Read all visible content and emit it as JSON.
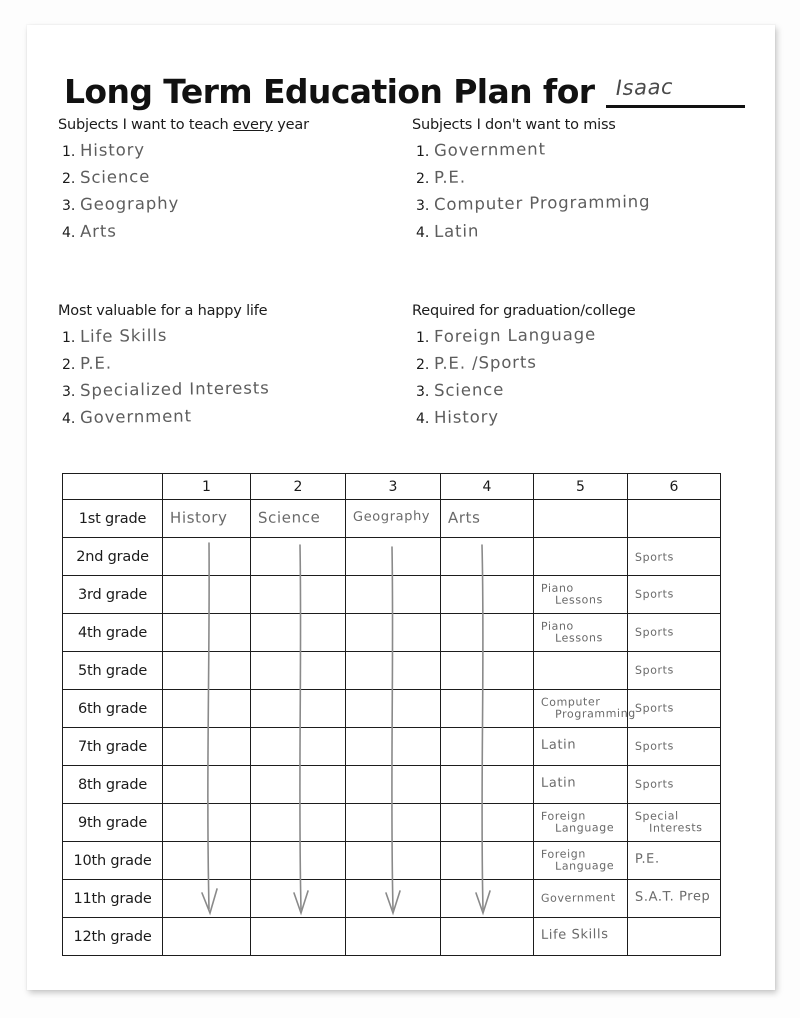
{
  "title": {
    "text": "Long Term Education Plan for",
    "name_value": "Isaac"
  },
  "lists": [
    {
      "heading_before": "Subjects I want to teach ",
      "heading_underline": "every",
      "heading_after": " year",
      "items": [
        "History",
        "Science",
        "Geography",
        "Arts"
      ],
      "numbers": [
        "1.",
        "2.",
        "3.",
        "4."
      ]
    },
    {
      "heading_before": "Subjects I don't want to miss",
      "heading_underline": "",
      "heading_after": "",
      "items": [
        "Government",
        "P.E.",
        "Computer Programming",
        "Latin"
      ],
      "numbers": [
        "1.",
        "2.",
        "3.",
        "4."
      ]
    },
    {
      "heading_before": "Most valuable for a happy life",
      "heading_underline": "",
      "heading_after": "",
      "items": [
        "Life Skills",
        "P.E.",
        "Specialized Interests",
        "Government"
      ],
      "numbers": [
        "1.",
        "2.",
        "3.",
        "4."
      ]
    },
    {
      "heading_before": "Required for graduation/college",
      "heading_underline": "",
      "heading_after": "",
      "items": [
        "Foreign Language",
        "P.E. /Sports",
        "Science",
        "History"
      ],
      "numbers": [
        "1.",
        "2.",
        "3.",
        "4."
      ]
    }
  ],
  "grid": {
    "corner_label": "",
    "columns": [
      "1",
      "2",
      "3",
      "4",
      "5",
      "6"
    ],
    "rows": [
      {
        "label": "1st grade",
        "cells": [
          "History",
          "Science",
          "Geography",
          "Arts",
          "",
          ""
        ]
      },
      {
        "label": "2nd grade",
        "cells": [
          "",
          "",
          "",
          "",
          "",
          "Sports"
        ]
      },
      {
        "label": "3rd grade",
        "cells": [
          "",
          "",
          "",
          "",
          "Piano Lessons",
          "Sports"
        ]
      },
      {
        "label": "4th grade",
        "cells": [
          "",
          "",
          "",
          "",
          "Piano Lessons",
          "Sports"
        ]
      },
      {
        "label": "5th grade",
        "cells": [
          "",
          "",
          "",
          "",
          "",
          "Sports"
        ]
      },
      {
        "label": "6th grade",
        "cells": [
          "",
          "",
          "",
          "",
          "Computer Programming",
          "Sports"
        ]
      },
      {
        "label": "7th grade",
        "cells": [
          "",
          "",
          "",
          "",
          "Latin",
          "Sports"
        ]
      },
      {
        "label": "8th grade",
        "cells": [
          "",
          "",
          "",
          "",
          "Latin",
          "Sports"
        ]
      },
      {
        "label": "9th grade",
        "cells": [
          "",
          "",
          "",
          "",
          "Foreign Language",
          "Special Interests"
        ]
      },
      {
        "label": "10th grade",
        "cells": [
          "",
          "",
          "",
          "",
          "Foreign Language",
          "P.E."
        ]
      },
      {
        "label": "11th grade",
        "cells": [
          "",
          "",
          "",
          "",
          "Government",
          "S.A.T. Prep"
        ]
      },
      {
        "label": "12th grade",
        "cells": [
          "",
          "",
          "",
          "",
          "Life Skills",
          ""
        ]
      }
    ],
    "continuation_arrows": {
      "description": "pencil arrows drawn down columns 1-4 from 1st grade to 12th grade",
      "columns": [
        1,
        2,
        3,
        4
      ]
    }
  },
  "colors": {
    "ink_print": "#1b1b1b",
    "ink_hand": "#6a6a6a",
    "page": "#ffffff",
    "background": "#fdfdfd"
  }
}
